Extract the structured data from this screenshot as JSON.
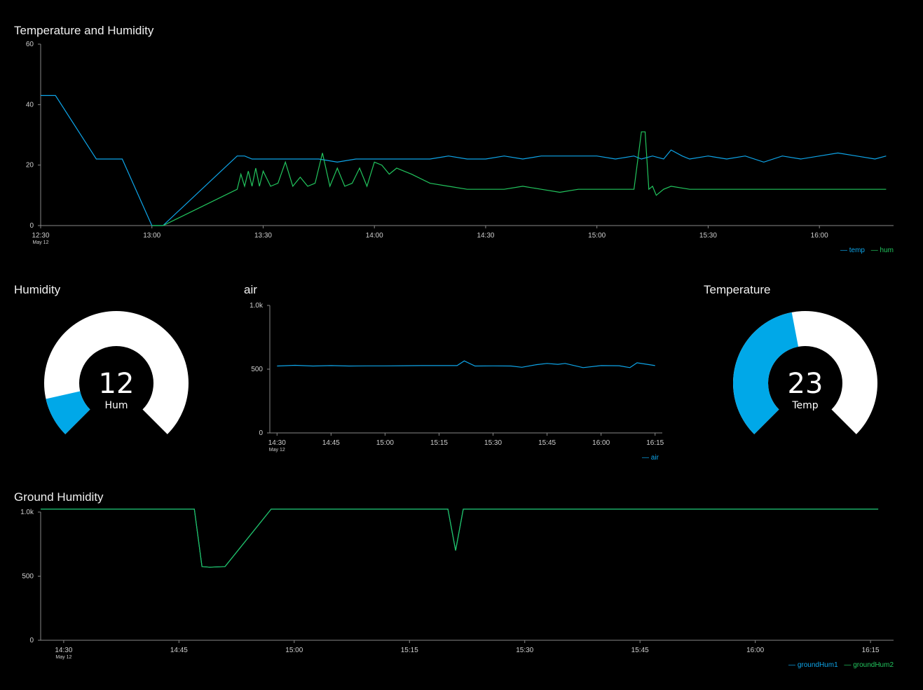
{
  "colors": {
    "background": "#000000",
    "blue": "#0ea5e9",
    "green": "#22c55e",
    "teal": "#14b89a",
    "axis": "#888888",
    "gauge_track": "#ffffff",
    "gauge_fill": "#00a8e8"
  },
  "chart_data": [
    {
      "id": "temp-hum",
      "type": "line",
      "title": "Temperature and Humidity",
      "ylim": [
        0,
        60
      ],
      "yticks": [
        "0",
        "20",
        "40",
        "60"
      ],
      "xlim": [
        "12:30",
        "16:20"
      ],
      "xticks": [
        "12:30",
        "13:00",
        "13:30",
        "14:00",
        "14:30",
        "15:00",
        "15:30",
        "16:00"
      ],
      "xtick_sub": "May 12",
      "legend": "bottom-right",
      "series": [
        {
          "name": "temp",
          "color": "#0ea5e9",
          "x": [
            "12:30",
            "12:34",
            "12:45",
            "12:52",
            "13:00",
            "13:03",
            "13:23",
            "13:25",
            "13:27",
            "13:30",
            "13:35",
            "13:40",
            "13:45",
            "13:50",
            "13:55",
            "14:00",
            "14:05",
            "14:10",
            "14:15",
            "14:20",
            "14:25",
            "14:30",
            "14:35",
            "14:40",
            "14:45",
            "14:50",
            "14:55",
            "15:00",
            "15:05",
            "15:10",
            "15:12",
            "15:15",
            "15:18",
            "15:20",
            "15:23",
            "15:25",
            "15:30",
            "15:35",
            "15:40",
            "15:45",
            "15:50",
            "15:55",
            "16:00",
            "16:05",
            "16:10",
            "16:15",
            "16:18"
          ],
          "y": [
            43,
            43,
            22,
            22,
            0,
            0,
            23,
            23,
            22,
            22,
            22,
            22,
            22,
            21,
            22,
            22,
            22,
            22,
            22,
            23,
            22,
            22,
            23,
            22,
            23,
            23,
            23,
            23,
            22,
            23,
            22,
            23,
            22,
            25,
            23,
            22,
            23,
            22,
            23,
            21,
            23,
            22,
            23,
            24,
            23,
            22,
            23
          ]
        },
        {
          "name": "hum",
          "color": "#22c55e",
          "x": [
            "13:00",
            "13:03",
            "13:23",
            "13:24",
            "13:25",
            "13:26",
            "13:27",
            "13:28",
            "13:29",
            "13:30",
            "13:32",
            "13:34",
            "13:36",
            "13:38",
            "13:40",
            "13:42",
            "13:44",
            "13:46",
            "13:48",
            "13:50",
            "13:52",
            "13:54",
            "13:56",
            "13:58",
            "14:00",
            "14:02",
            "14:04",
            "14:06",
            "14:08",
            "14:10",
            "14:15",
            "14:20",
            "14:25",
            "14:30",
            "14:35",
            "14:40",
            "14:45",
            "14:50",
            "14:55",
            "15:00",
            "15:05",
            "15:10",
            "15:12",
            "15:13",
            "15:14",
            "15:15",
            "15:16",
            "15:18",
            "15:20",
            "15:25",
            "15:30",
            "15:35",
            "15:40",
            "15:45",
            "15:50",
            "15:55",
            "16:00",
            "16:05",
            "16:10",
            "16:15",
            "16:18"
          ],
          "y": [
            0,
            0,
            12,
            17,
            13,
            18,
            13,
            19,
            13,
            18,
            13,
            14,
            21,
            13,
            16,
            13,
            14,
            24,
            13,
            19,
            13,
            14,
            19,
            13,
            21,
            20,
            17,
            19,
            18,
            17,
            14,
            13,
            12,
            12,
            12,
            13,
            12,
            11,
            12,
            12,
            12,
            12,
            31,
            31,
            12,
            13,
            10,
            12,
            13,
            12,
            12,
            12,
            12,
            12,
            12,
            12,
            12,
            12,
            12,
            12,
            12
          ]
        }
      ]
    },
    {
      "id": "humidity-gauge",
      "type": "gauge",
      "title": "Humidity",
      "value": 12,
      "label": "Hum",
      "min": 0,
      "max": 100
    },
    {
      "id": "air",
      "type": "line",
      "title": "air",
      "ylim": [
        0,
        1000
      ],
      "yticks": [
        "0",
        "500",
        "1.0k"
      ],
      "xlim": [
        "14:28",
        "16:17"
      ],
      "xticks": [
        "14:30",
        "14:45",
        "15:00",
        "15:15",
        "15:30",
        "15:45",
        "16:00",
        "16:15"
      ],
      "xtick_sub": "May 12",
      "legend": "bottom-right",
      "series": [
        {
          "name": "air",
          "color": "#0ea5e9",
          "x": [
            "14:30",
            "14:35",
            "14:40",
            "14:45",
            "14:50",
            "14:55",
            "15:00",
            "15:05",
            "15:10",
            "15:15",
            "15:20",
            "15:22",
            "15:25",
            "15:30",
            "15:35",
            "15:38",
            "15:42",
            "15:45",
            "15:48",
            "15:50",
            "15:55",
            "16:00",
            "16:05",
            "16:08",
            "16:10",
            "16:15"
          ],
          "y": [
            525,
            530,
            525,
            528,
            525,
            526,
            526,
            527,
            528,
            528,
            528,
            565,
            525,
            526,
            525,
            515,
            535,
            545,
            538,
            545,
            512,
            528,
            527,
            512,
            550,
            528
          ]
        }
      ]
    },
    {
      "id": "temperature-gauge",
      "type": "gauge",
      "title": "Temperature",
      "value": 23,
      "label": "Temp",
      "min": 0,
      "max": 50
    },
    {
      "id": "ground",
      "type": "line",
      "title": "Ground Humidity",
      "ylim": [
        0,
        1000
      ],
      "yticks": [
        "0",
        "500",
        "1.0k"
      ],
      "xlim": [
        "14:27",
        "16:18"
      ],
      "xticks": [
        "14:30",
        "14:45",
        "15:00",
        "15:15",
        "15:30",
        "15:45",
        "16:00",
        "16:15"
      ],
      "xtick_sub": "May 12",
      "legend": "bottom-right",
      "series": [
        {
          "name": "groundHum1",
          "color": "#0ea5e9",
          "x": [
            "14:27",
            "14:47",
            "14:48",
            "14:49",
            "14:51",
            "14:57",
            "15:20",
            "15:21",
            "15:22",
            "16:16"
          ],
          "y": [
            1023,
            1023,
            575,
            570,
            575,
            1023,
            1023,
            700,
            1023,
            1023
          ]
        },
        {
          "name": "groundHum2",
          "color": "#22c55e",
          "x": [
            "14:27",
            "14:47",
            "14:48",
            "14:49",
            "14:51",
            "14:57",
            "15:20",
            "15:21",
            "15:22",
            "16:16"
          ],
          "y": [
            1023,
            1023,
            575,
            570,
            575,
            1023,
            1023,
            700,
            1023,
            1023
          ]
        }
      ]
    }
  ]
}
